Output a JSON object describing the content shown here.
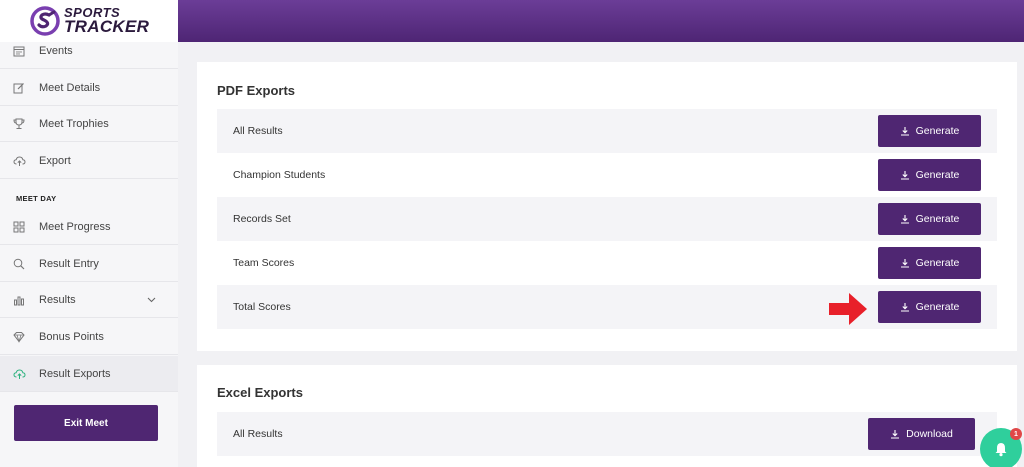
{
  "app": {
    "logo_line1": "SPORTS",
    "logo_line2": "TRACKER"
  },
  "sidebar": {
    "items": [
      {
        "label": "Events",
        "icon": "calendar-icon"
      },
      {
        "label": "Meet Details",
        "icon": "edit-icon"
      },
      {
        "label": "Meet Trophies",
        "icon": "trophy-icon"
      },
      {
        "label": "Export",
        "icon": "cloud-upload-icon"
      },
      {
        "label": "Meet Progress",
        "icon": "grid-icon"
      },
      {
        "label": "Result Entry",
        "icon": "search-icon"
      },
      {
        "label": "Results",
        "icon": "bar-chart-icon"
      },
      {
        "label": "Bonus Points",
        "icon": "diamond-icon"
      },
      {
        "label": "Result Exports",
        "icon": "cloud-upload-icon"
      }
    ],
    "section_label": "MEET DAY",
    "exit_label": "Exit Meet"
  },
  "pdf_exports": {
    "title": "PDF Exports",
    "button_label": "Generate",
    "rows": [
      "All Results",
      "Champion Students",
      "Records Set",
      "Team Scores",
      "Total Scores"
    ]
  },
  "excel_exports": {
    "title": "Excel Exports",
    "button_label": "Download",
    "rows": [
      "All Results"
    ]
  },
  "notifications": {
    "count": "1"
  },
  "colors": {
    "brand_purple": "#4f2672",
    "accent_green": "#2fcf9c",
    "arrow_red": "#e8202a"
  }
}
